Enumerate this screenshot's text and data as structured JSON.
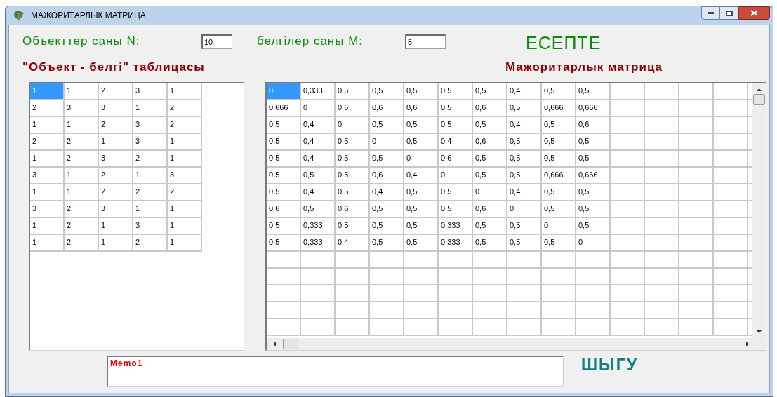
{
  "window": {
    "title": "МАЖОРИТАРЛЫК МАТРИЦА"
  },
  "objects_field": {
    "label": "Объекттер саны N:",
    "value": "10"
  },
  "features_field": {
    "label": "белгілер саны M:",
    "value": "5"
  },
  "calculate_button": {
    "label": "ЕСЕПТЕ"
  },
  "object_table": {
    "title": "\"Объект - белгі\" таблицасы",
    "rows": [
      [
        {
          "text": "1",
          "selected": true
        },
        {
          "text": "1",
          "selected": false
        },
        {
          "text": "2",
          "selected": false
        },
        {
          "text": "3",
          "selected": false
        },
        {
          "text": "1",
          "selected": false
        }
      ],
      [
        {
          "text": "2",
          "selected": false
        },
        {
          "text": "3",
          "selected": false
        },
        {
          "text": "3",
          "selected": false
        },
        {
          "text": "1",
          "selected": false
        },
        {
          "text": "2",
          "selected": false
        }
      ],
      [
        {
          "text": "1",
          "selected": false
        },
        {
          "text": "1",
          "selected": false
        },
        {
          "text": "2",
          "selected": false
        },
        {
          "text": "3",
          "selected": false
        },
        {
          "text": "2",
          "selected": false
        }
      ],
      [
        {
          "text": "2",
          "selected": false
        },
        {
          "text": "2",
          "selected": false
        },
        {
          "text": "1",
          "selected": false
        },
        {
          "text": "3",
          "selected": false
        },
        {
          "text": "1",
          "selected": false
        }
      ],
      [
        {
          "text": "1",
          "selected": false
        },
        {
          "text": "2",
          "selected": false
        },
        {
          "text": "3",
          "selected": false
        },
        {
          "text": "2",
          "selected": false
        },
        {
          "text": "1",
          "selected": false
        }
      ],
      [
        {
          "text": "3",
          "selected": false
        },
        {
          "text": "1",
          "selected": false
        },
        {
          "text": "2",
          "selected": false
        },
        {
          "text": "1",
          "selected": false
        },
        {
          "text": "3",
          "selected": false
        }
      ],
      [
        {
          "text": "1",
          "selected": false
        },
        {
          "text": "1",
          "selected": false
        },
        {
          "text": "2",
          "selected": false
        },
        {
          "text": "2",
          "selected": false
        },
        {
          "text": "2",
          "selected": false
        }
      ],
      [
        {
          "text": "3",
          "selected": false
        },
        {
          "text": "2",
          "selected": false
        },
        {
          "text": "3",
          "selected": false
        },
        {
          "text": "1",
          "selected": false
        },
        {
          "text": "1",
          "selected": false
        }
      ],
      [
        {
          "text": "1",
          "selected": false
        },
        {
          "text": "2",
          "selected": false
        },
        {
          "text": "1",
          "selected": false
        },
        {
          "text": "3",
          "selected": false
        },
        {
          "text": "1",
          "selected": false
        }
      ],
      [
        {
          "text": "1",
          "selected": false
        },
        {
          "text": "2",
          "selected": false
        },
        {
          "text": "1",
          "selected": false
        },
        {
          "text": "2",
          "selected": false
        },
        {
          "text": "1",
          "selected": false
        }
      ]
    ]
  },
  "majority_matrix": {
    "title": "Мажоритарлык матрица",
    "rows": [
      [
        {
          "text": "0",
          "selected": true
        },
        {
          "text": "0,333",
          "selected": false
        },
        {
          "text": "0,5",
          "selected": false
        },
        {
          "text": "0,5",
          "selected": false
        },
        {
          "text": "0,5",
          "selected": false
        },
        {
          "text": "0,5",
          "selected": false
        },
        {
          "text": "0,5",
          "selected": false
        },
        {
          "text": "0,4",
          "selected": false
        },
        {
          "text": "0,5",
          "selected": false
        },
        {
          "text": "0,5",
          "selected": false
        }
      ],
      [
        {
          "text": "0,666",
          "selected": false
        },
        {
          "text": "0",
          "selected": false
        },
        {
          "text": "0,6",
          "selected": false
        },
        {
          "text": "0,6",
          "selected": false
        },
        {
          "text": "0,6",
          "selected": false
        },
        {
          "text": "0,5",
          "selected": false
        },
        {
          "text": "0,6",
          "selected": false
        },
        {
          "text": "0,5",
          "selected": false
        },
        {
          "text": "0,666",
          "selected": false
        },
        {
          "text": "0,666",
          "selected": false
        }
      ],
      [
        {
          "text": "0,5",
          "selected": false
        },
        {
          "text": "0,4",
          "selected": false
        },
        {
          "text": "0",
          "selected": false
        },
        {
          "text": "0,5",
          "selected": false
        },
        {
          "text": "0,5",
          "selected": false
        },
        {
          "text": "0,5",
          "selected": false
        },
        {
          "text": "0,5",
          "selected": false
        },
        {
          "text": "0,4",
          "selected": false
        },
        {
          "text": "0,5",
          "selected": false
        },
        {
          "text": "0,6",
          "selected": false
        }
      ],
      [
        {
          "text": "0,5",
          "selected": false
        },
        {
          "text": "0,4",
          "selected": false
        },
        {
          "text": "0,5",
          "selected": false
        },
        {
          "text": "0",
          "selected": false
        },
        {
          "text": "0,5",
          "selected": false
        },
        {
          "text": "0,4",
          "selected": false
        },
        {
          "text": "0,6",
          "selected": false
        },
        {
          "text": "0,5",
          "selected": false
        },
        {
          "text": "0,5",
          "selected": false
        },
        {
          "text": "0,5",
          "selected": false
        }
      ],
      [
        {
          "text": "0,5",
          "selected": false
        },
        {
          "text": "0,4",
          "selected": false
        },
        {
          "text": "0,5",
          "selected": false
        },
        {
          "text": "0,5",
          "selected": false
        },
        {
          "text": "0",
          "selected": false
        },
        {
          "text": "0,6",
          "selected": false
        },
        {
          "text": "0,5",
          "selected": false
        },
        {
          "text": "0,5",
          "selected": false
        },
        {
          "text": "0,5",
          "selected": false
        },
        {
          "text": "0,5",
          "selected": false
        }
      ],
      [
        {
          "text": "0,5",
          "selected": false
        },
        {
          "text": "0,5",
          "selected": false
        },
        {
          "text": "0,5",
          "selected": false
        },
        {
          "text": "0,6",
          "selected": false
        },
        {
          "text": "0,4",
          "selected": false
        },
        {
          "text": "0",
          "selected": false
        },
        {
          "text": "0,5",
          "selected": false
        },
        {
          "text": "0,5",
          "selected": false
        },
        {
          "text": "0,666",
          "selected": false
        },
        {
          "text": "0,666",
          "selected": false
        }
      ],
      [
        {
          "text": "0,5",
          "selected": false
        },
        {
          "text": "0,4",
          "selected": false
        },
        {
          "text": "0,5",
          "selected": false
        },
        {
          "text": "0,4",
          "selected": false
        },
        {
          "text": "0,5",
          "selected": false
        },
        {
          "text": "0,5",
          "selected": false
        },
        {
          "text": "0",
          "selected": false
        },
        {
          "text": "0,4",
          "selected": false
        },
        {
          "text": "0,5",
          "selected": false
        },
        {
          "text": "0,5",
          "selected": false
        }
      ],
      [
        {
          "text": "0,6",
          "selected": false
        },
        {
          "text": "0,5",
          "selected": false
        },
        {
          "text": "0,6",
          "selected": false
        },
        {
          "text": "0,5",
          "selected": false
        },
        {
          "text": "0,5",
          "selected": false
        },
        {
          "text": "0,5",
          "selected": false
        },
        {
          "text": "0,6",
          "selected": false
        },
        {
          "text": "0",
          "selected": false
        },
        {
          "text": "0,5",
          "selected": false
        },
        {
          "text": "0,5",
          "selected": false
        }
      ],
      [
        {
          "text": "0,5",
          "selected": false
        },
        {
          "text": "0,333",
          "selected": false
        },
        {
          "text": "0,5",
          "selected": false
        },
        {
          "text": "0,5",
          "selected": false
        },
        {
          "text": "0,5",
          "selected": false
        },
        {
          "text": "0,333",
          "selected": false
        },
        {
          "text": "0,5",
          "selected": false
        },
        {
          "text": "0,5",
          "selected": false
        },
        {
          "text": "0",
          "selected": false
        },
        {
          "text": "0,5",
          "selected": false
        }
      ],
      [
        {
          "text": "0,5",
          "selected": false
        },
        {
          "text": "0,333",
          "selected": false
        },
        {
          "text": "0,4",
          "selected": false
        },
        {
          "text": "0,5",
          "selected": false
        },
        {
          "text": "0,5",
          "selected": false
        },
        {
          "text": "0,333",
          "selected": false
        },
        {
          "text": "0,5",
          "selected": false
        },
        {
          "text": "0,5",
          "selected": false
        },
        {
          "text": "0,5",
          "selected": false
        },
        {
          "text": "0",
          "selected": false
        }
      ]
    ]
  },
  "memo": {
    "value": "Memo1"
  },
  "exit_button": {
    "label": "ШЫГУ"
  }
}
